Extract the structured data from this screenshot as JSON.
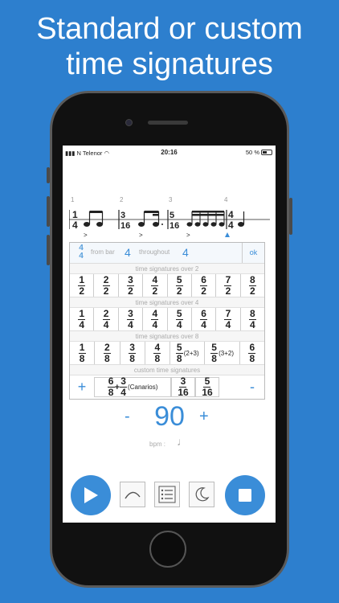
{
  "headline": {
    "line1": "Standard or custom",
    "line2": "time signatures"
  },
  "status": {
    "carrier": "N Telenor",
    "time": "20:16",
    "battery": "50 %"
  },
  "staff": {
    "bar_numbers": [
      "1",
      "2",
      "3",
      "4"
    ],
    "signatures": [
      {
        "num": "1",
        "den": "4"
      },
      {
        "num": "3",
        "den": "16"
      },
      {
        "num": "5",
        "den": "16"
      },
      {
        "num": "4",
        "den": "4"
      }
    ]
  },
  "editor": {
    "current": {
      "num": "4",
      "den": "4"
    },
    "from_bar_label": "from bar",
    "from_bar_value": "4",
    "throughout_label": "throughout",
    "throughout_value": "4",
    "ok_label": "ok"
  },
  "sections": {
    "over2": {
      "title": "time signatures over 2",
      "items": [
        [
          "1",
          "2"
        ],
        [
          "2",
          "2"
        ],
        [
          "3",
          "2"
        ],
        [
          "4",
          "2"
        ],
        [
          "5",
          "2"
        ],
        [
          "6",
          "2"
        ],
        [
          "7",
          "2"
        ],
        [
          "8",
          "2"
        ]
      ]
    },
    "over4": {
      "title": "time signatures over 4",
      "items": [
        [
          "1",
          "4"
        ],
        [
          "2",
          "4"
        ],
        [
          "3",
          "4"
        ],
        [
          "4",
          "4"
        ],
        [
          "5",
          "4"
        ],
        [
          "6",
          "4"
        ],
        [
          "7",
          "4"
        ],
        [
          "8",
          "4"
        ]
      ]
    },
    "over8": {
      "title": "time signatures over 8",
      "items": [
        [
          "1",
          "8"
        ],
        [
          "2",
          "8"
        ],
        [
          "3",
          "8"
        ],
        [
          "4",
          "8"
        ],
        [
          "5",
          "8",
          "(2+3)"
        ],
        [
          "5",
          "8",
          "(3+2)"
        ],
        [
          "6",
          "8"
        ]
      ]
    },
    "custom": {
      "title": "custom time signatures",
      "add_label": "+",
      "remove_label": "-",
      "canarios": {
        "a_num": "6",
        "a_den": "8",
        "plus": "+",
        "b_num": "3",
        "b_den": "4",
        "name": "(Canarios)"
      },
      "c1": {
        "num": "3",
        "den": "16"
      },
      "c2": {
        "num": "5",
        "den": "16"
      }
    }
  },
  "tempo": {
    "minus": "-",
    "value": "90",
    "plus": "+",
    "bpm_label": "bpm :",
    "note_glyph": "♩"
  },
  "colors": {
    "accent": "#3a8dd8",
    "background": "#2d7fce"
  }
}
